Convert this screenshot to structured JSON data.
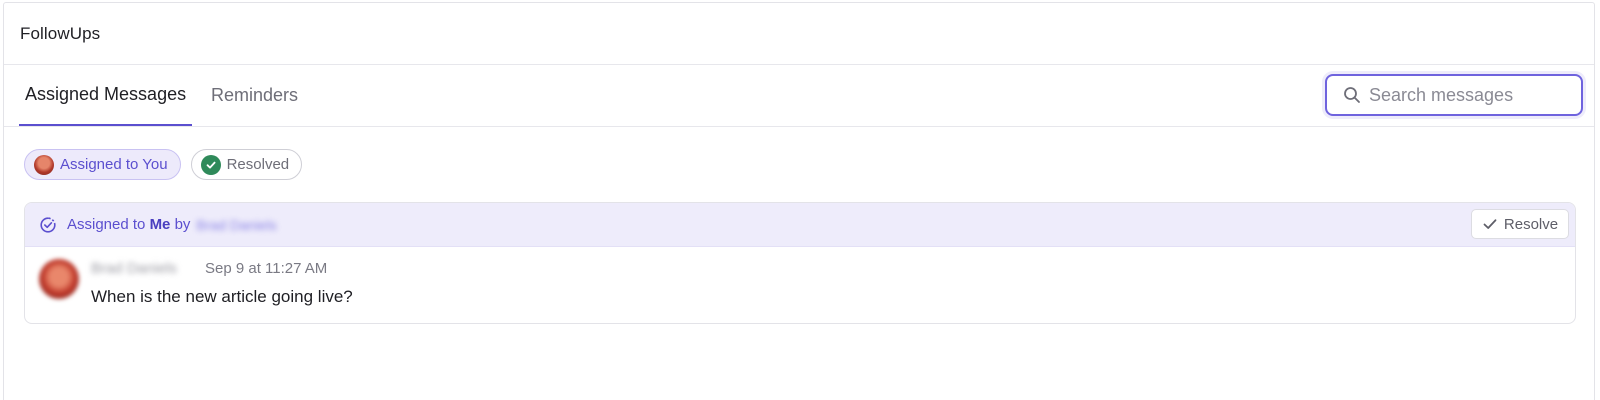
{
  "header": {
    "title": "FollowUps"
  },
  "tabs": [
    {
      "label": "Assigned Messages",
      "active": true
    },
    {
      "label": "Reminders",
      "active": false
    }
  ],
  "search": {
    "placeholder": "Search messages",
    "value": ""
  },
  "filters": [
    {
      "label": "Assigned to You",
      "icon": "user-avatar",
      "selected": true
    },
    {
      "label": "Resolved",
      "icon": "check-circle-icon",
      "selected": false
    }
  ],
  "assignment": {
    "prefix": "Assigned to",
    "target": "Me",
    "by_label": "by",
    "assigner": "Brad Daniels",
    "resolve_label": "Resolve"
  },
  "message": {
    "author": "Brad Daniels",
    "timestamp": "Sep 9 at 11:27 AM",
    "text": "When is the new article going live?"
  },
  "colors": {
    "accent": "#5b4fcf",
    "resolved_green": "#2f8a5a",
    "banner_bg": "#eeecfb"
  }
}
